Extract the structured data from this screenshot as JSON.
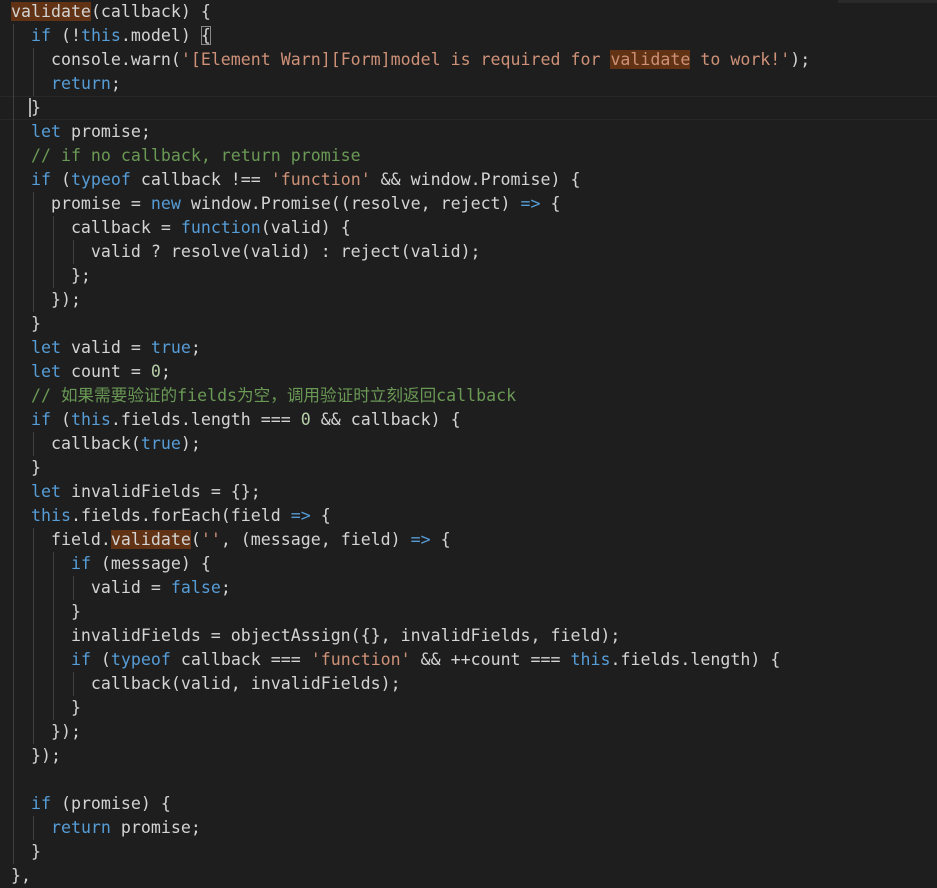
{
  "editor": {
    "language": "javascript",
    "search_highlight": "validate",
    "lines": [
      [
        [
          "tk-match",
          "validate"
        ],
        [
          "tk-txt",
          "(callback) {"
        ]
      ],
      [
        [
          "tk-txt",
          "  "
        ],
        [
          "tk-kw",
          "if"
        ],
        [
          "tk-txt",
          " (!"
        ],
        [
          "tk-kw",
          "this"
        ],
        [
          "tk-txt",
          ".model) "
        ],
        [
          "tk-br",
          "{"
        ]
      ],
      [
        [
          "tk-txt",
          "    console.warn("
        ],
        [
          "tk-str",
          "'[Element Warn][Form]model is required for "
        ],
        [
          "tk-strmatch",
          "validate"
        ],
        [
          "tk-str",
          " to work!'"
        ],
        [
          "tk-txt",
          ");"
        ]
      ],
      [
        [
          "tk-txt",
          "    "
        ],
        [
          "tk-kw",
          "return"
        ],
        [
          "tk-txt",
          ";"
        ]
      ],
      [
        [
          "tk-txt",
          "  "
        ],
        [
          "tk-cursor",
          "}"
        ]
      ],
      [
        [
          "tk-txt",
          "  "
        ],
        [
          "tk-kw",
          "let"
        ],
        [
          "tk-txt",
          " promise;"
        ]
      ],
      [
        [
          "tk-txt",
          "  "
        ],
        [
          "tk-com",
          "// if no callback, return promise"
        ]
      ],
      [
        [
          "tk-txt",
          "  "
        ],
        [
          "tk-kw",
          "if"
        ],
        [
          "tk-txt",
          " ("
        ],
        [
          "tk-kw",
          "typeof"
        ],
        [
          "tk-txt",
          " callback !== "
        ],
        [
          "tk-str",
          "'function'"
        ],
        [
          "tk-txt",
          " && window.Promise) {"
        ]
      ],
      [
        [
          "tk-txt",
          "    promise = "
        ],
        [
          "tk-kw",
          "new"
        ],
        [
          "tk-txt",
          " window.Promise((resolve, reject) "
        ],
        [
          "tk-kw",
          "=>"
        ],
        [
          "tk-txt",
          " {"
        ]
      ],
      [
        [
          "tk-txt",
          "      callback = "
        ],
        [
          "tk-kw",
          "function"
        ],
        [
          "tk-txt",
          "(valid) {"
        ]
      ],
      [
        [
          "tk-txt",
          "        valid ? resolve(valid) : reject(valid);"
        ]
      ],
      [
        [
          "tk-txt",
          "      };"
        ]
      ],
      [
        [
          "tk-txt",
          "    });"
        ]
      ],
      [
        [
          "tk-txt",
          "  }"
        ]
      ],
      [
        [
          "tk-txt",
          "  "
        ],
        [
          "tk-kw",
          "let"
        ],
        [
          "tk-txt",
          " valid = "
        ],
        [
          "tk-kw",
          "true"
        ],
        [
          "tk-txt",
          ";"
        ]
      ],
      [
        [
          "tk-txt",
          "  "
        ],
        [
          "tk-kw",
          "let"
        ],
        [
          "tk-txt",
          " count = "
        ],
        [
          "tk-num",
          "0"
        ],
        [
          "tk-txt",
          ";"
        ]
      ],
      [
        [
          "tk-txt",
          "  "
        ],
        [
          "tk-com",
          "// 如果需要验证的fields为空，调用验证时立刻返回callback"
        ]
      ],
      [
        [
          "tk-txt",
          "  "
        ],
        [
          "tk-kw",
          "if"
        ],
        [
          "tk-txt",
          " ("
        ],
        [
          "tk-kw",
          "this"
        ],
        [
          "tk-txt",
          ".fields.length === "
        ],
        [
          "tk-num",
          "0"
        ],
        [
          "tk-txt",
          " && callback) {"
        ]
      ],
      [
        [
          "tk-txt",
          "    callback("
        ],
        [
          "tk-kw",
          "true"
        ],
        [
          "tk-txt",
          ");"
        ]
      ],
      [
        [
          "tk-txt",
          "  }"
        ]
      ],
      [
        [
          "tk-txt",
          "  "
        ],
        [
          "tk-kw",
          "let"
        ],
        [
          "tk-txt",
          " invalidFields = {};"
        ]
      ],
      [
        [
          "tk-txt",
          "  "
        ],
        [
          "tk-kw",
          "this"
        ],
        [
          "tk-txt",
          ".fields.forEach(field "
        ],
        [
          "tk-kw",
          "=>"
        ],
        [
          "tk-txt",
          " {"
        ]
      ],
      [
        [
          "tk-txt",
          "    field."
        ],
        [
          "tk-match",
          "validate"
        ],
        [
          "tk-txt",
          "("
        ],
        [
          "tk-str",
          "''"
        ],
        [
          "tk-txt",
          ", (message, field) "
        ],
        [
          "tk-kw",
          "=>"
        ],
        [
          "tk-txt",
          " {"
        ]
      ],
      [
        [
          "tk-txt",
          "      "
        ],
        [
          "tk-kw",
          "if"
        ],
        [
          "tk-txt",
          " (message) {"
        ]
      ],
      [
        [
          "tk-txt",
          "        valid = "
        ],
        [
          "tk-kw",
          "false"
        ],
        [
          "tk-txt",
          ";"
        ]
      ],
      [
        [
          "tk-txt",
          "      }"
        ]
      ],
      [
        [
          "tk-txt",
          "      invalidFields = objectAssign({}, invalidFields, field);"
        ]
      ],
      [
        [
          "tk-txt",
          "      "
        ],
        [
          "tk-kw",
          "if"
        ],
        [
          "tk-txt",
          " ("
        ],
        [
          "tk-kw",
          "typeof"
        ],
        [
          "tk-txt",
          " callback === "
        ],
        [
          "tk-str",
          "'function'"
        ],
        [
          "tk-txt",
          " && ++count === "
        ],
        [
          "tk-kw",
          "this"
        ],
        [
          "tk-txt",
          ".fields.length) {"
        ]
      ],
      [
        [
          "tk-txt",
          "        callback(valid, invalidFields);"
        ]
      ],
      [
        [
          "tk-txt",
          "      }"
        ]
      ],
      [
        [
          "tk-txt",
          "    });"
        ]
      ],
      [
        [
          "tk-txt",
          "  });"
        ]
      ],
      [],
      [
        [
          "tk-txt",
          "  "
        ],
        [
          "tk-kw",
          "if"
        ],
        [
          "tk-txt",
          " (promise) {"
        ]
      ],
      [
        [
          "tk-txt",
          "    "
        ],
        [
          "tk-kw",
          "return"
        ],
        [
          "tk-txt",
          " promise;"
        ]
      ],
      [
        [
          "tk-txt",
          "  }"
        ]
      ],
      [
        [
          "tk-txt",
          "},"
        ]
      ]
    ]
  }
}
